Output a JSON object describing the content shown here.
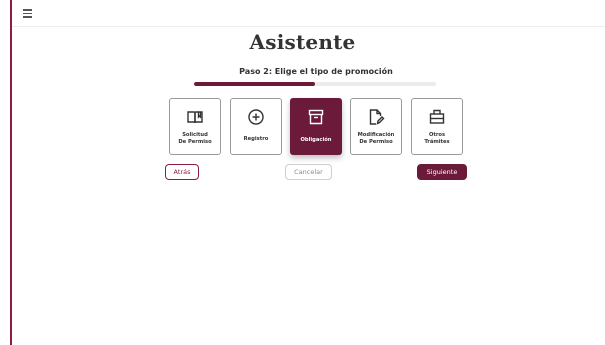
{
  "colors": {
    "accent": "#6b1a3a",
    "rail": "#8c1d3e",
    "track": "#ebebeb"
  },
  "topbar": {
    "menu_icon": "hamburger-menu-icon"
  },
  "wizard": {
    "title": "Asistente",
    "step_label": "Paso 2: Elige el tipo de promoción",
    "progress": 0.5
  },
  "options": [
    {
      "line1": "Solicitud",
      "line2": "De Permiso",
      "icon": "open-book-icon",
      "selected": false
    },
    {
      "line1": "Registro",
      "line2": "",
      "icon": "plus-circle-icon",
      "selected": false
    },
    {
      "line1": "Obligación",
      "line2": "",
      "icon": "archive-box-icon",
      "selected": true
    },
    {
      "line1": "Modificación",
      "line2": "De Permiso",
      "icon": "edit-document-icon",
      "selected": false
    },
    {
      "line1": "Otros",
      "line2": "Trámites",
      "icon": "briefcase-icon",
      "selected": false
    }
  ],
  "buttons": {
    "back": "Atrás",
    "cancel": "Cancelar",
    "next": "Siguiente"
  }
}
